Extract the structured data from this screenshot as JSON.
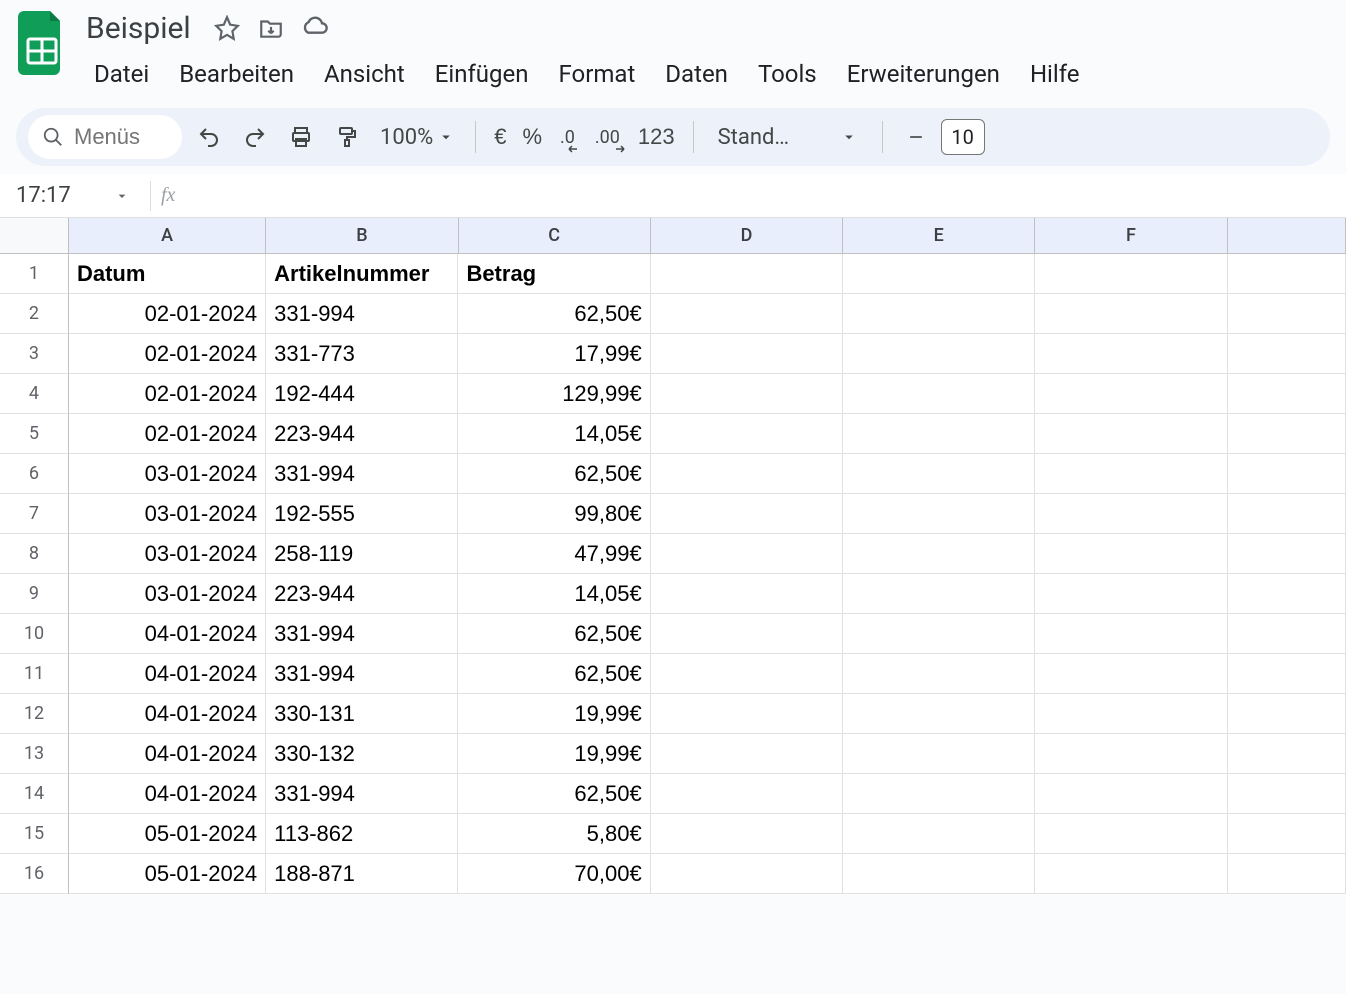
{
  "doc": {
    "title": "Beispiel"
  },
  "menus": {
    "file": "Datei",
    "edit": "Bearbeiten",
    "view": "Ansicht",
    "insert": "Einfügen",
    "format": "Format",
    "data": "Daten",
    "tools": "Tools",
    "extensions": "Erweiterungen",
    "help": "Hilfe"
  },
  "toolbar": {
    "search_placeholder": "Menüs",
    "zoom": "100%",
    "currency": "€",
    "percent": "%",
    "decrease_decimal": ".0",
    "increase_decimal": ".00",
    "number_format": "123",
    "font": "Stand…",
    "font_size_value": "10"
  },
  "namebox": {
    "ref": "17:17"
  },
  "columns": [
    "A",
    "B",
    "C",
    "D",
    "E",
    "F"
  ],
  "sheet": {
    "headers": {
      "A": "Datum",
      "B": "Artikelnummer",
      "C": "Betrag"
    },
    "rows": [
      {
        "n": 1,
        "A": "Datum",
        "B": "Artikelnummer",
        "C": "Betrag",
        "hdr": true
      },
      {
        "n": 2,
        "A": "02-01-2024",
        "B": "331-994",
        "C": "62,50€"
      },
      {
        "n": 3,
        "A": "02-01-2024",
        "B": "331-773",
        "C": "17,99€"
      },
      {
        "n": 4,
        "A": "02-01-2024",
        "B": "192-444",
        "C": "129,99€"
      },
      {
        "n": 5,
        "A": "02-01-2024",
        "B": "223-944",
        "C": "14,05€"
      },
      {
        "n": 6,
        "A": "03-01-2024",
        "B": "331-994",
        "C": "62,50€"
      },
      {
        "n": 7,
        "A": "03-01-2024",
        "B": "192-555",
        "C": "99,80€"
      },
      {
        "n": 8,
        "A": "03-01-2024",
        "B": "258-119",
        "C": "47,99€"
      },
      {
        "n": 9,
        "A": "03-01-2024",
        "B": "223-944",
        "C": "14,05€"
      },
      {
        "n": 10,
        "A": "04-01-2024",
        "B": "331-994",
        "C": "62,50€"
      },
      {
        "n": 11,
        "A": "04-01-2024",
        "B": "331-994",
        "C": "62,50€"
      },
      {
        "n": 12,
        "A": "04-01-2024",
        "B": "330-131",
        "C": "19,99€"
      },
      {
        "n": 13,
        "A": "04-01-2024",
        "B": "330-132",
        "C": "19,99€"
      },
      {
        "n": 14,
        "A": "04-01-2024",
        "B": "331-994",
        "C": "62,50€"
      },
      {
        "n": 15,
        "A": "05-01-2024",
        "B": "113-862",
        "C": "5,80€"
      },
      {
        "n": 16,
        "A": "05-01-2024",
        "B": "188-871",
        "C": "70,00€"
      }
    ]
  }
}
